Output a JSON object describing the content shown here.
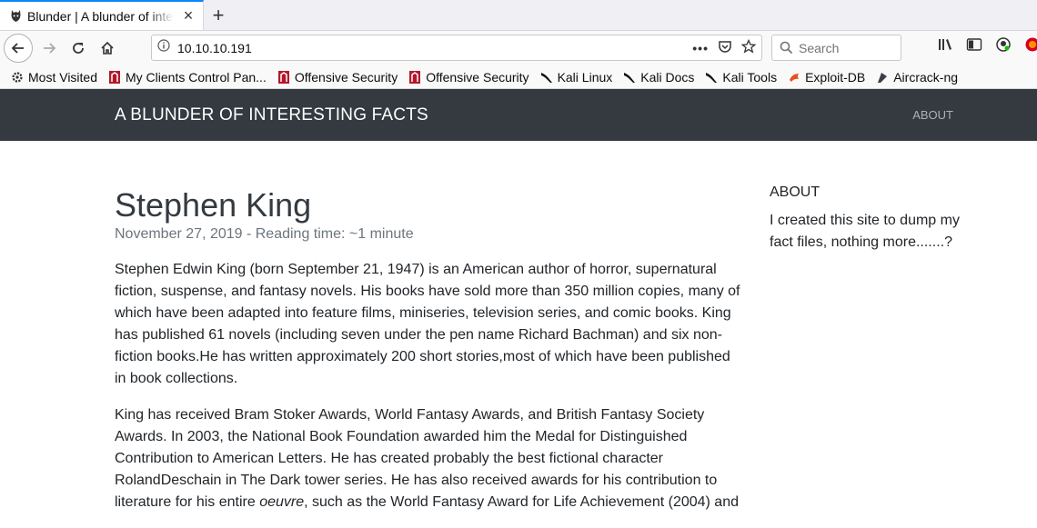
{
  "browser": {
    "tab_title": "Blunder | A blunder of interesting facts",
    "url": "10.10.10.191",
    "search_placeholder": "Search",
    "new_tab_symbol": "+",
    "close_symbol": "×"
  },
  "bookmarks": [
    {
      "label": "Most Visited",
      "icon": "gear-icon"
    },
    {
      "label": "My Clients Control Pan...",
      "icon": "offsec-icon"
    },
    {
      "label": "Offensive Security",
      "icon": "offsec-icon"
    },
    {
      "label": "Offensive Security",
      "icon": "offsec-icon"
    },
    {
      "label": "Kali Linux",
      "icon": "kali-dragon-icon"
    },
    {
      "label": "Kali Docs",
      "icon": "kali-dragon-icon"
    },
    {
      "label": "Kali Tools",
      "icon": "kali-dragon-icon"
    },
    {
      "label": "Exploit-DB",
      "icon": "exploitdb-icon"
    },
    {
      "label": "Aircrack-ng",
      "icon": "aircrack-icon"
    }
  ],
  "site": {
    "brand": "A BLUNDER OF INTERESTING FACTS",
    "nav_about": "ABOUT"
  },
  "post": {
    "title": "Stephen King",
    "meta": "November 27, 2019 - Reading time: ~1 minute",
    "p1": "Stephen Edwin King (born September 21, 1947) is an American author of horror, supernatural fiction, suspense, and fantasy novels. His books have sold more than 350 million copies, many of which have been adapted into feature films, miniseries, television series, and comic books. King has published 61 novels (including seven under the pen name Richard Bachman) and six non-fiction books.He has written approximately 200 short stories,most of which have been published in book collections.",
    "p2_before": "King has received Bram Stoker Awards, World Fantasy Awards, and British Fantasy Society Awards. In 2003, the National Book Foundation awarded him the Medal for Distinguished Contribution to American Letters. He has created probably the best fictional character RolandDeschain in The Dark tower series. He has also received awards for his contribution to literature for his entire ",
    "p2_em": "oeuvre",
    "p2_after": ", such as the World Fantasy Award for Life Achievement (2004) and"
  },
  "sidebar": {
    "heading": "ABOUT",
    "text": "I created this site to dump my fact files, nothing more.......?"
  },
  "colors": {
    "site_nav_bg": "#343a40",
    "tab_accent": "#0a84ff"
  }
}
